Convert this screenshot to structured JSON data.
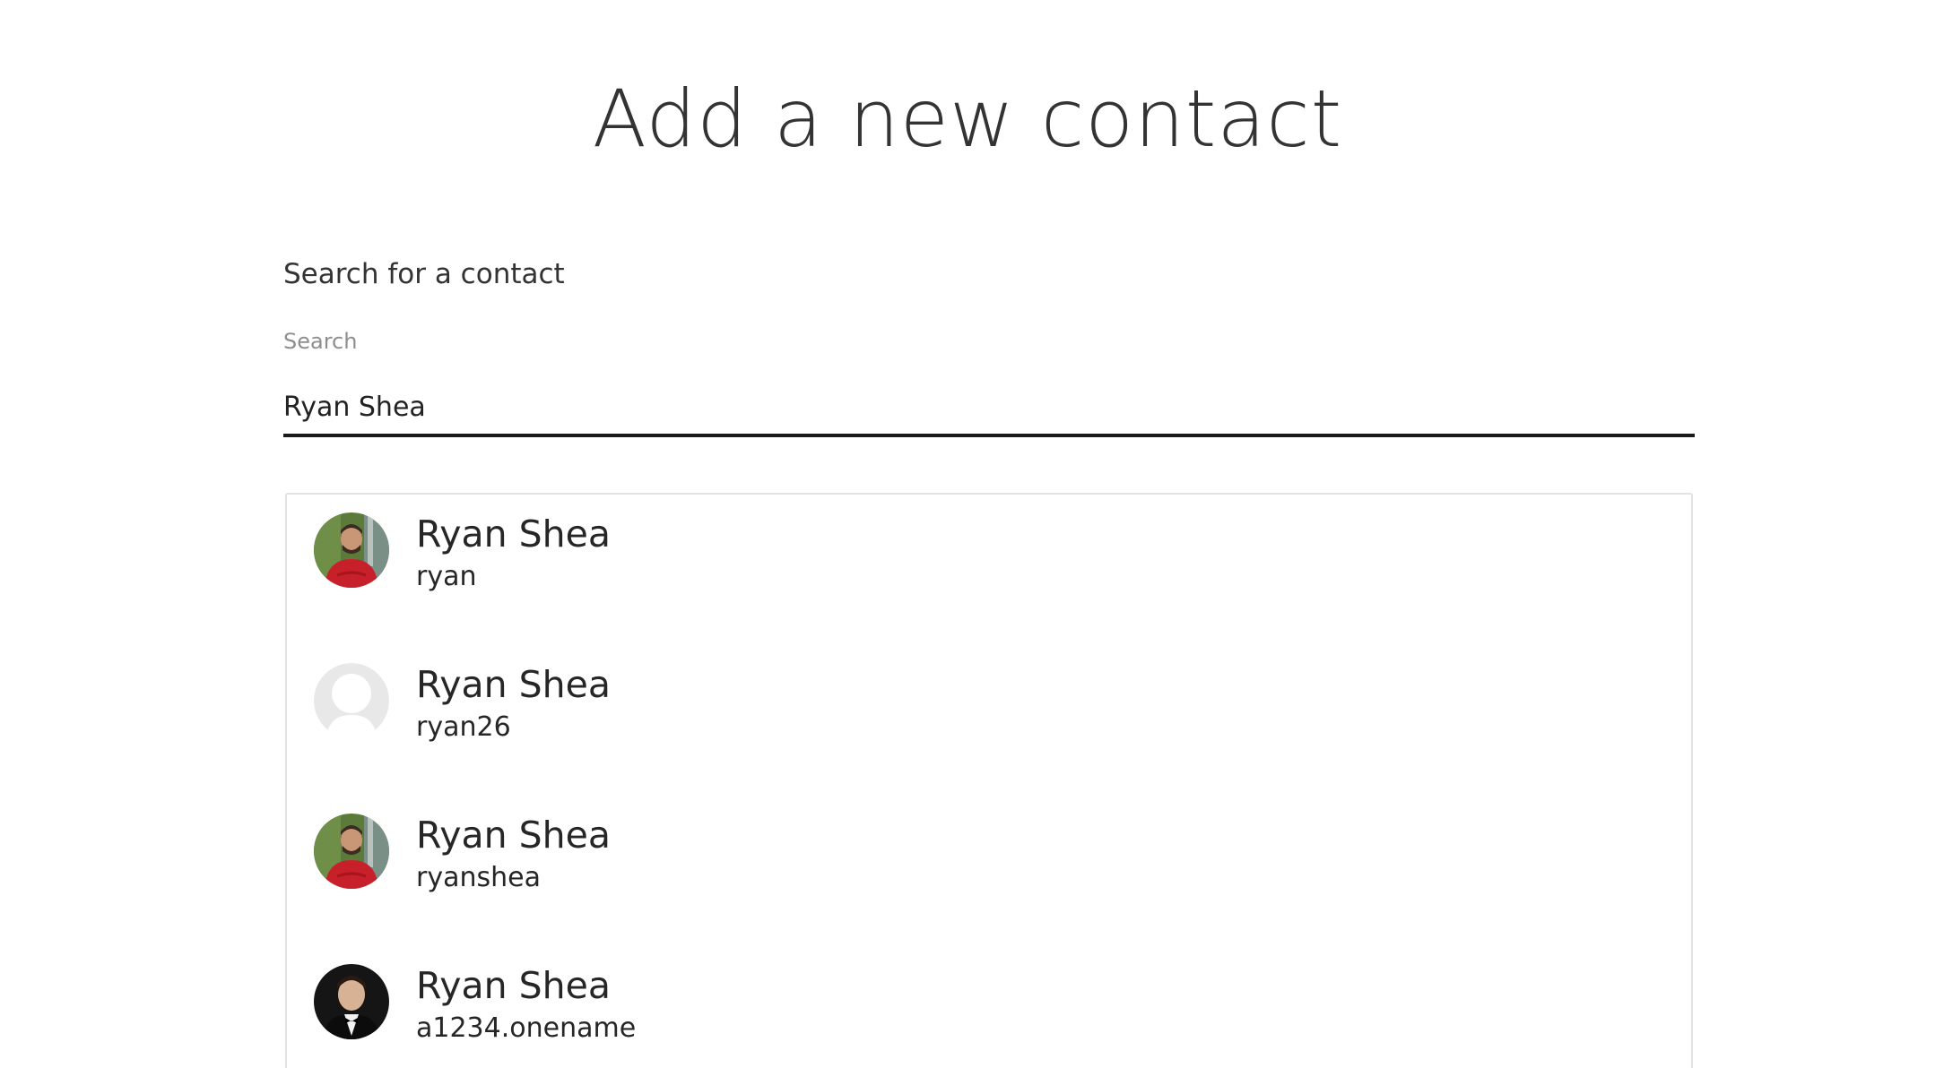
{
  "page": {
    "title": "Add a new contact"
  },
  "search": {
    "heading": "Search for a contact",
    "label": "Search",
    "value": "Ryan Shea"
  },
  "results": [
    {
      "name": "Ryan Shea",
      "username": "ryan",
      "avatar": "photo-red-sweater"
    },
    {
      "name": "Ryan Shea",
      "username": "ryan26",
      "avatar": "default-placeholder"
    },
    {
      "name": "Ryan Shea",
      "username": "ryanshea",
      "avatar": "photo-red-sweater"
    },
    {
      "name": "Ryan Shea",
      "username": "a1234.onename",
      "avatar": "photo-tuxedo"
    }
  ],
  "colors": {
    "underline": "#1a1a1a",
    "results_border": "#e2e2e2",
    "label_gray": "#8e8e8e"
  }
}
